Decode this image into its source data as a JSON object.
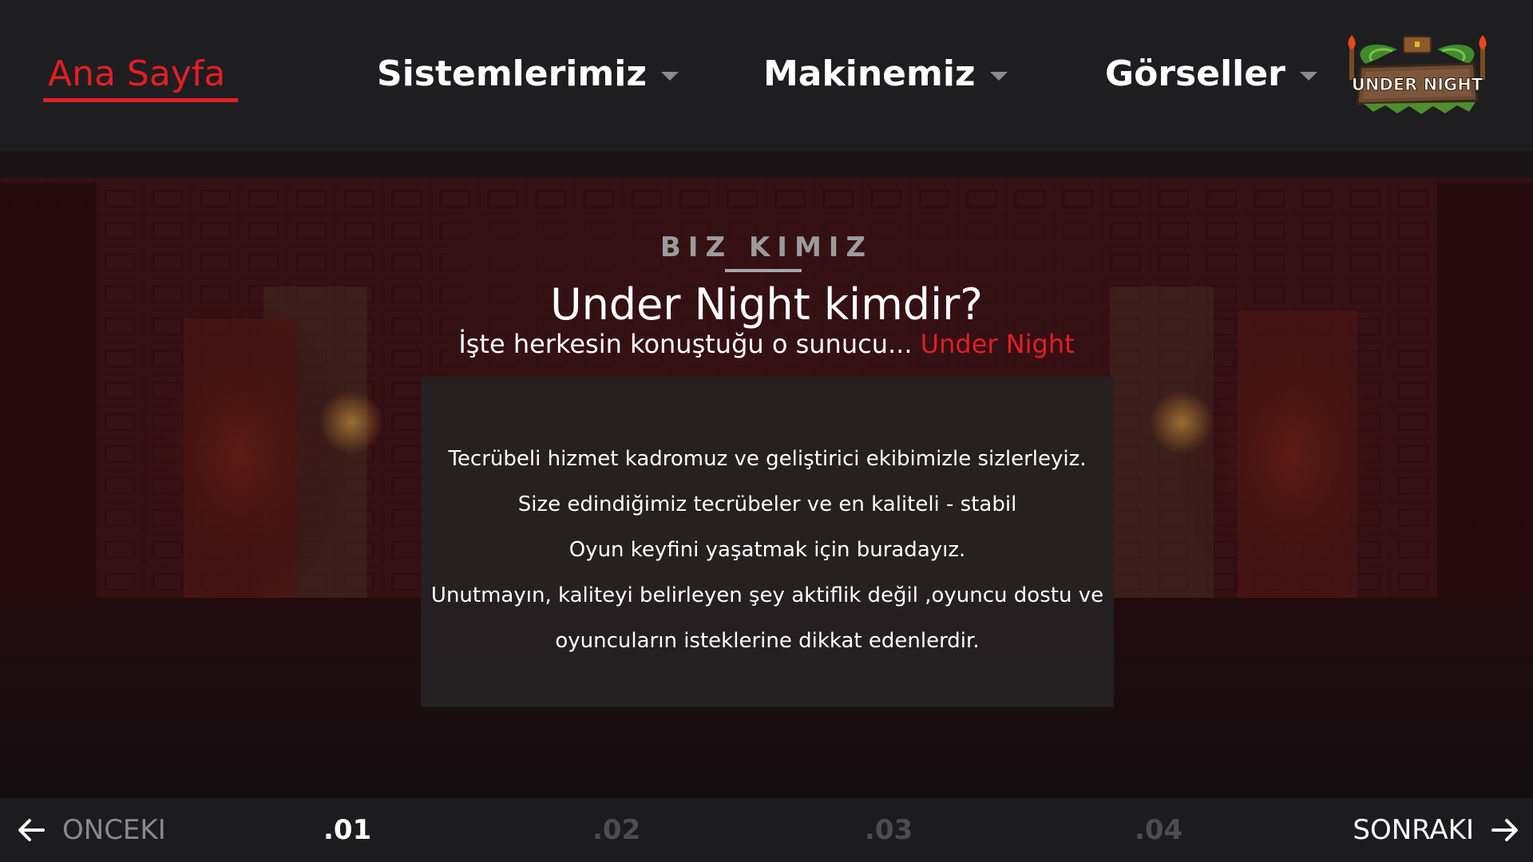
{
  "nav": {
    "items": [
      {
        "label": "Ana Sayfa",
        "active": true
      },
      {
        "label": "Sistemlerimiz",
        "dropdown": true
      },
      {
        "label": "Makinemiz",
        "dropdown": true
      },
      {
        "label": "Görseller",
        "dropdown": true
      }
    ],
    "logo": {
      "text": "UNDER NIGHT"
    }
  },
  "about": {
    "tag": "BIZ KIMIZ",
    "title": "Under Night kimdir?",
    "subtitle_prefix": "İşte herkesin konuştuğu o sunucu...",
    "subtitle_accent": "Under Night",
    "paragraphs": [
      "Tecrübeli hizmet kadromuz ve geliştirici ekibimizle sizlerleyiz.",
      "Size edindiğimiz tecrübeler ve en kaliteli - stabil",
      "Oyun keyfini yaşatmak için buradayız.",
      "Unutmayın, kaliteyi belirleyen şey aktiflik değil ,oyuncu dostu ve",
      "oyuncuların isteklerine dikkat edenlerdir."
    ]
  },
  "pager": {
    "prev_label": "ONCEKI",
    "next_label": "SONRAKI",
    "pages": [
      ".01",
      ".02",
      ".03",
      ".04"
    ],
    "active_page": ".01"
  },
  "colors": {
    "accent": "#e31e24",
    "nav_bg": "#1e1e20",
    "panel_bg": "#262223"
  },
  "icons": {
    "prev": "arrow-left-icon",
    "next": "arrow-right-icon",
    "dropdown": "caret-down-icon"
  }
}
